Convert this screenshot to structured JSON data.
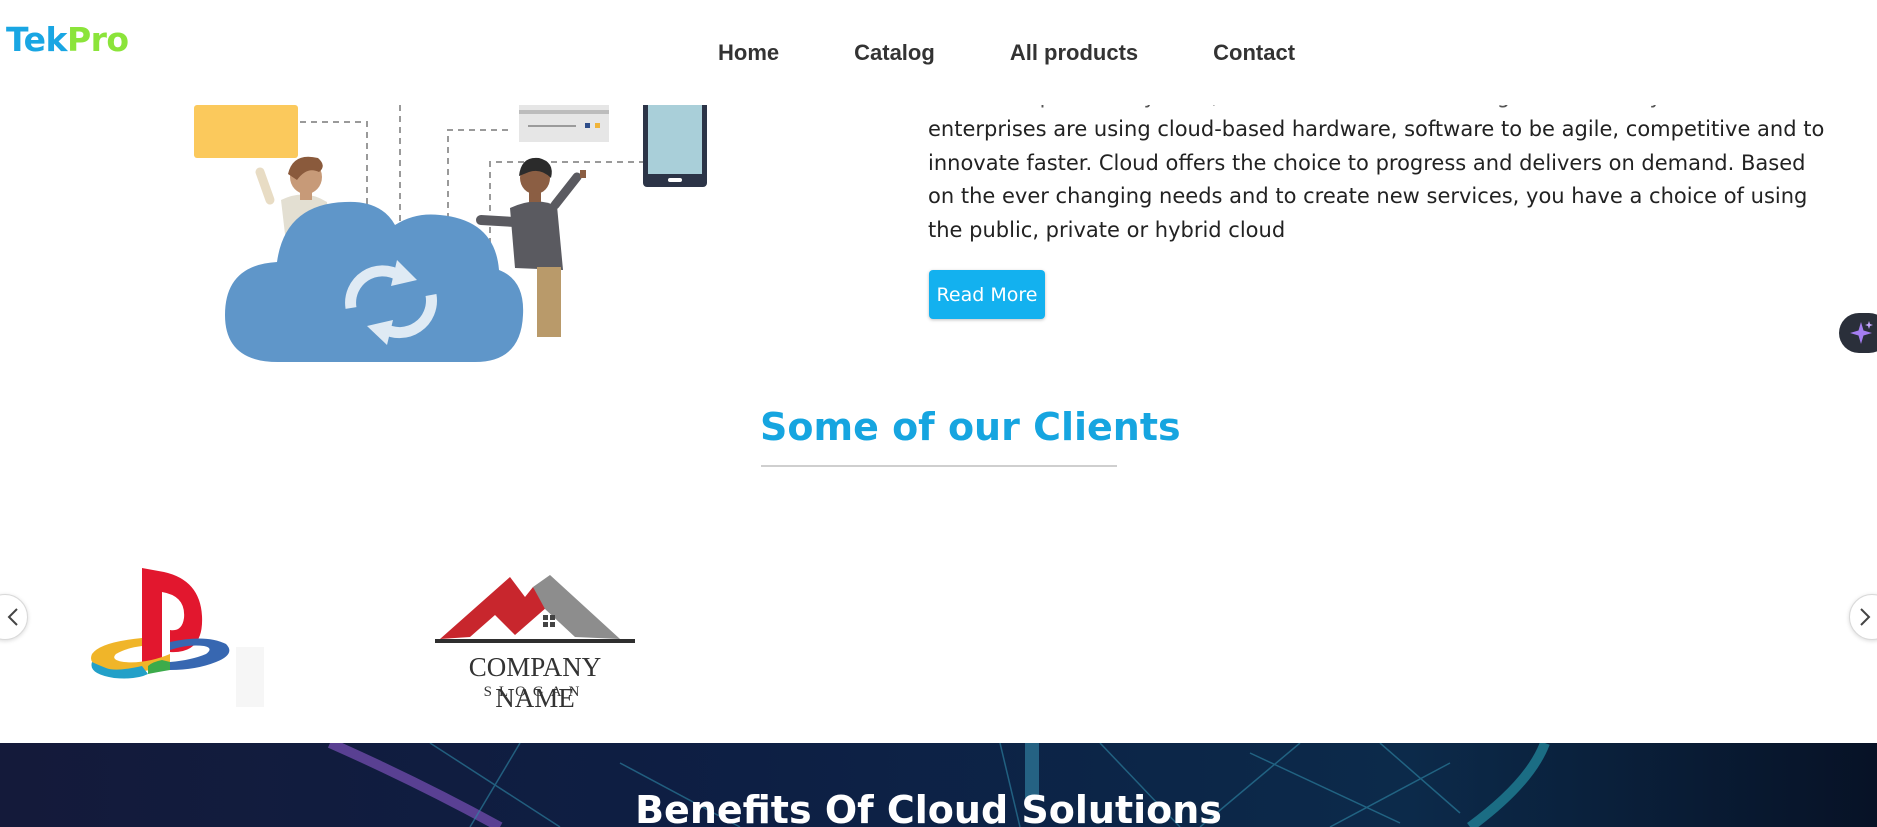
{
  "brand": {
    "logo_part1": "Tek",
    "logo_part2": "Pro"
  },
  "nav": {
    "items": [
      {
        "label": "Home"
      },
      {
        "label": "Catalog"
      },
      {
        "label": "All products"
      },
      {
        "label": "Contact"
      }
    ]
  },
  "hero": {
    "partial_line": "…………… p…… ……y …… , …………… ……… …… ……g ………… ……y",
    "paragraph": "enterprises are using cloud-based hardware, software to be agile, competitive and to innovate faster. Cloud offers the choice to progress and delivers on demand. Based on the ever changing needs and to create new services, you have a choice of using the public, private or hybrid cloud",
    "read_more_label": "Read More"
  },
  "clients": {
    "title": "Some of our Clients",
    "logos": [
      {
        "name": "playstation-logo"
      },
      {
        "name": "company-logo",
        "text": "COMPANY NAME",
        "slogan": "SLOGAN"
      }
    ]
  },
  "benefits": {
    "title": "Benefits Of Cloud Solutions"
  },
  "colors": {
    "accent": "#16a5e0",
    "button": "#13b1ef",
    "logo_tek": "#19a6e3",
    "logo_pro": "#8be43a",
    "banner_bg": "#0a1430"
  }
}
